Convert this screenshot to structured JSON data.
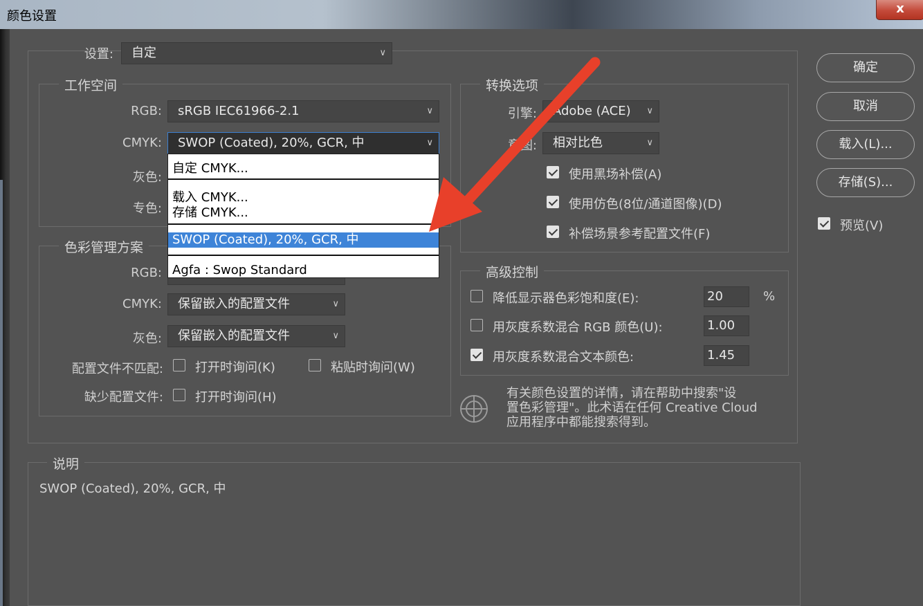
{
  "window": {
    "title": "颜色设置",
    "close_label": "x"
  },
  "settings": {
    "label": "设置:",
    "value": "自定"
  },
  "workspace": {
    "title": "工作空间",
    "rgb_label": "RGB:",
    "rgb_value": "sRGB IEC61966-2.1",
    "cmyk_label": "CMYK:",
    "cmyk_value": "SWOP (Coated), 20%, GCR, 中",
    "gray_label": "灰色:",
    "spot_label": "专色:"
  },
  "cmyk_dropdown": {
    "items": [
      "自定 CMYK...",
      "载入 CMYK...",
      "存储 CMYK...",
      "SWOP (Coated), 20%, GCR, 中",
      "Agfa : Swop Standard"
    ],
    "selected": "SWOP (Coated), 20%, GCR, 中"
  },
  "color_policy": {
    "title": "色彩管理方案",
    "rgb_label": "RGB:",
    "cmyk_label": "CMYK:",
    "cmyk_value": "保留嵌入的配置文件",
    "gray_label": "灰色:",
    "gray_value": "保留嵌入的配置文件",
    "mismatch_label": "配置文件不匹配:",
    "mismatch_open": "打开时询问(K)",
    "mismatch_paste": "粘贴时询问(W)",
    "missing_label": "缺少配置文件:",
    "missing_open": "打开时询问(H)"
  },
  "conversion": {
    "title": "转换选项",
    "engine_label": "引擎:",
    "engine_value": "Adobe (ACE)",
    "intent_label": "意图:",
    "intent_value": "相对比色",
    "black_point": "使用黑场补偿(A)",
    "dither": "使用仿色(8位/通道图像)(D)",
    "compensate": "补偿场景参考配置文件(F)"
  },
  "advanced": {
    "title": "高级控制",
    "desaturate_label": "降低显示器色彩饱和度(E):",
    "desaturate_value": "20",
    "desaturate_unit": "%",
    "blend_rgb_label": "用灰度系数混合 RGB 颜色(U):",
    "blend_rgb_value": "1.00",
    "blend_text_label": "用灰度系数混合文本颜色:",
    "blend_text_value": "1.45"
  },
  "info": {
    "line1": "有关颜色设置的详情，请在帮助中搜索\"设",
    "line2": "置色彩管理\"。此术语在任何 Creative Cloud",
    "line3": "应用程序中都能搜索得到。"
  },
  "description": {
    "title": "说明",
    "text": "SWOP (Coated), 20%, GCR, 中"
  },
  "buttons": {
    "ok": "确定",
    "cancel": "取消",
    "load": "载入(L)...",
    "save": "存储(S)...",
    "preview": "预览(V)"
  },
  "colors": {
    "annotation_arrow": "#e8402a",
    "selection": "#3e84d8",
    "background": "#535353"
  }
}
